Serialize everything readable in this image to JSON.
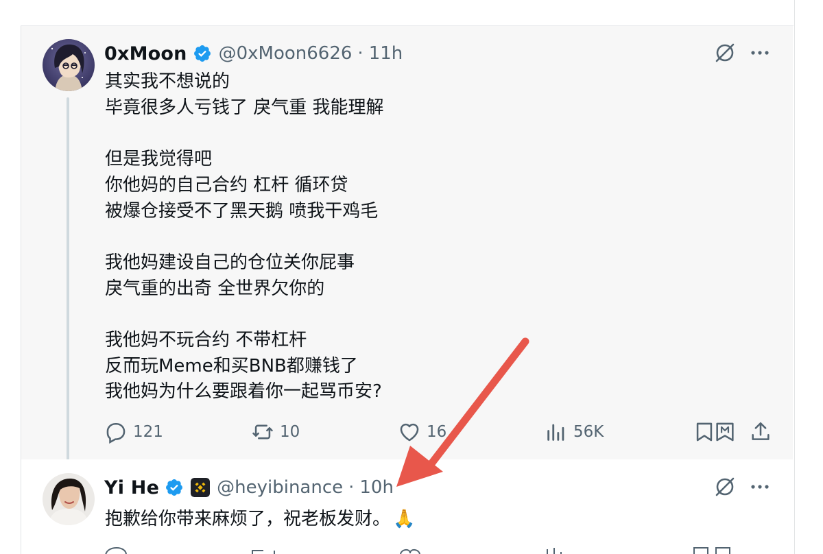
{
  "tweets": [
    {
      "display_name": "0xMoon",
      "handle": "@0xMoon6626",
      "separator": "·",
      "time": "11h",
      "text": "其实我不想说的\n毕竟很多人亏钱了 戾气重 我能理解\n\n但是我觉得吧\n你他妈的自己合约 杠杆 循环贷\n被爆仓接受不了黑天鹅 喷我干鸡毛\n\n我他妈建设自己的仓位关你屁事\n戾气重的出奇 全世界欠你的\n\n我他妈不玩合约 不带杠杆\n反而玩Meme和买BNB都赚钱了\n我他妈为什么要跟着你一起骂币安?",
      "stats": {
        "replies": "121",
        "reposts": "10",
        "likes": "16",
        "views": "56K"
      },
      "icons": [
        "verified-badge-icon",
        "grok-icon",
        "more-icon",
        "reply-icon",
        "repost-icon",
        "like-icon",
        "views-icon",
        "bookmark-icon",
        "share-icon"
      ]
    },
    {
      "display_name": "Yi He",
      "handle": "@heyibinance",
      "separator": "·",
      "time": "10h",
      "text": "抱歉给你带来麻烦了，祝老板发财。",
      "emoji": "🙏",
      "icons": [
        "verified-badge-icon",
        "binance-affiliate-badge-icon",
        "grok-icon",
        "more-icon"
      ]
    }
  ],
  "colors": {
    "verified_blue": "#1d9bf0",
    "text_primary": "#0f1419",
    "text_secondary": "#536471",
    "highlight_bg": "#f7f7f7",
    "annotation_arrow": "#e8574b",
    "binance_yellow": "#f0b90b"
  },
  "annotation": {
    "type": "arrow",
    "points_to": "tweets.1.time"
  }
}
